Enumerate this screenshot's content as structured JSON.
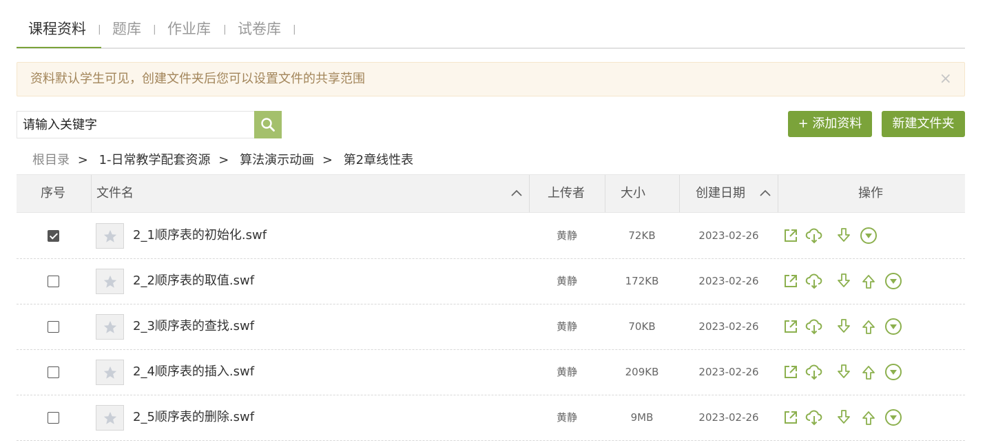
{
  "tabs": [
    {
      "label": "课程资料",
      "active": true
    },
    {
      "label": "题库",
      "active": false
    },
    {
      "label": "作业库",
      "active": false
    },
    {
      "label": "试卷库",
      "active": false
    }
  ],
  "tab_separator": "|",
  "notice": {
    "text": "资料默认学生可见，创建文件夹后您可以设置文件的共享范围",
    "close": "×"
  },
  "search": {
    "placeholder": "请输入关键字"
  },
  "buttons": {
    "add": "+ 添加资料",
    "new_folder": "新建文件夹"
  },
  "breadcrumb": {
    "items": [
      "根目录",
      "1-日常教学配套资源",
      "算法演示动画",
      "第2章线性表"
    ],
    "separator": ">"
  },
  "table": {
    "headers": {
      "index": "序号",
      "name": "文件名",
      "uploader": "上传者",
      "size": "大小",
      "date": "创建日期",
      "actions": "操作"
    },
    "rows": [
      {
        "checked": true,
        "name": "2_1顺序表的初始化.swf",
        "uploader": "黄静",
        "size": "72KB",
        "date": "2023-02-26",
        "can_move_up": false
      },
      {
        "checked": false,
        "name": "2_2顺序表的取值.swf",
        "uploader": "黄静",
        "size": "172KB",
        "date": "2023-02-26",
        "can_move_up": true
      },
      {
        "checked": false,
        "name": "2_3顺序表的查找.swf",
        "uploader": "黄静",
        "size": "70KB",
        "date": "2023-02-26",
        "can_move_up": true
      },
      {
        "checked": false,
        "name": "2_4顺序表的插入.swf",
        "uploader": "黄静",
        "size": "209KB",
        "date": "2023-02-26",
        "can_move_up": true
      },
      {
        "checked": false,
        "name": "2_5顺序表的删除.swf",
        "uploader": "黄静",
        "size": "9MB",
        "date": "2023-02-26",
        "can_move_up": true
      }
    ]
  },
  "colors": {
    "accent": "#7ba33a",
    "icon_green": "#8cb04e",
    "search_button": "#a4c06c",
    "notice_bg": "#fcf6ec",
    "notice_text": "#a2855a"
  }
}
